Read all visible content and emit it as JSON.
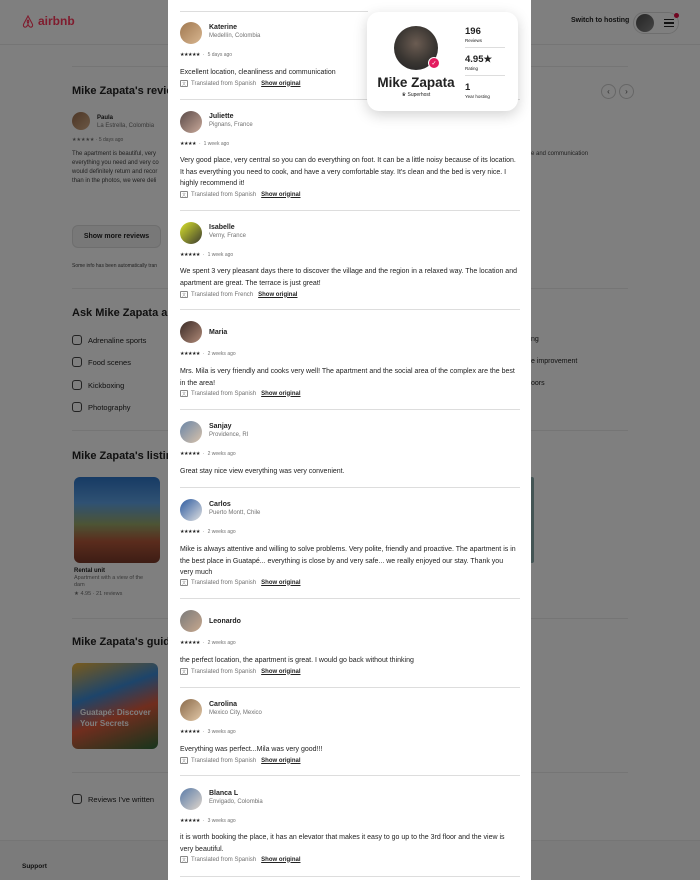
{
  "header": {
    "logo_text": "airbnb",
    "switch_label": "Switch to hosting",
    "brand_color": "#ff385c"
  },
  "background": {
    "reviews_title": "Mike Zapata's review",
    "bg_reviewer_name": "Paula",
    "bg_reviewer_loc": "La Estrella, Colombia",
    "bg_reviewer_meta": "★★★★★ · 5 days ago",
    "bg_review_text": "The apartment is beautiful, very everything you need and very co would definitely return and recor than in the photos, we were deli",
    "bg_right_text": "e and communication",
    "show_more": "Show more reviews",
    "auto_translate_note": "Some info has been automatically tran",
    "ask_title": "Ask Mike Zapata abo",
    "ask_items": [
      "Adrenaline sports",
      "Food scenes",
      "Kickboxing",
      "Photography"
    ],
    "ask_right_items": [
      "ng",
      "e improvement",
      "oors"
    ],
    "listings_title": "Mike Zapata's listings",
    "listing_type": "Rental unit",
    "listing_desc": "Apartment with a view of the dam",
    "listing_rating": "★ 4.95 · 21 reviews",
    "guide_title": "Mike Zapata's guideb",
    "guide_card": "Guatapé: Discover Your Secrets",
    "reviews_written": "Reviews I've written",
    "footer_support": "Support"
  },
  "profile": {
    "name": "Mike Zapata",
    "role": "Superhost",
    "reviews_value": "196",
    "reviews_label": "Reviews",
    "rating_value": "4.95★",
    "rating_label": "Rating",
    "years_value": "1",
    "years_label": "Year hosting"
  },
  "reviews": [
    {
      "name": "Katerine",
      "location": "Medellín, Colombia",
      "stars": "★★★★★",
      "time": "5 days ago",
      "text": "Excellent location, cleanliness and communication",
      "translated": "Translated from Spanish",
      "show_original": "Show original"
    },
    {
      "name": "Juliette",
      "location": "Pignans, France",
      "stars": "★★★★",
      "time": "1 week ago",
      "text": "Very good place, very central so you can do everything on foot. It can be a little noisy because of its location. It has everything you need to cook, and have a very comfortable stay. It's clean and the bed is very nice. I highly recommend it!",
      "translated": "Translated from Spanish",
      "show_original": "Show original"
    },
    {
      "name": "Isabelle",
      "location": "Verny, France",
      "stars": "★★★★★",
      "time": "1 week ago",
      "text": "We spent 3 very pleasant days there to discover the village and the region in a relaxed way. The location and apartment are great. The terrace is just great!",
      "translated": "Translated from French",
      "show_original": "Show original"
    },
    {
      "name": "Maria",
      "location": "",
      "stars": "★★★★★",
      "time": "2 weeks ago",
      "text": "Mrs. Mila is very friendly and cooks very well! The apartment and the social area of the complex are the best in the area!",
      "translated": "Translated from Spanish",
      "show_original": "Show original"
    },
    {
      "name": "Sanjay",
      "location": "Providence, RI",
      "stars": "★★★★★",
      "time": "2 weeks ago",
      "text": "Great stay nice view everything was very convenient.",
      "translated": "",
      "show_original": ""
    },
    {
      "name": "Carlos",
      "location": "Puerto Montt, Chile",
      "stars": "★★★★★",
      "time": "2 weeks ago",
      "text": "Mike is always attentive and willing to solve problems. Very polite, friendly and proactive. The apartment is in the best place in Guatapé... everything is close by and very safe... we really enjoyed our stay. Thank you very much",
      "translated": "Translated from Spanish",
      "show_original": "Show original"
    },
    {
      "name": "Leonardo",
      "location": "",
      "stars": "★★★★★",
      "time": "2 weeks ago",
      "text": "the perfect location, the apartment is great. I would go back without thinking",
      "translated": "Translated from Spanish",
      "show_original": "Show original"
    },
    {
      "name": "Carolina",
      "location": "Mexico City, Mexico",
      "stars": "★★★★★",
      "time": "3 weeks ago",
      "text": "Everything was perfect...Mila was very good!!!",
      "translated": "Translated from Spanish",
      "show_original": "Show original"
    },
    {
      "name": "Blanca L",
      "location": "Envigado, Colombia",
      "stars": "★★★★★",
      "time": "3 weeks ago",
      "text": "it is worth booking the place, it has an elevator that makes it easy to go up to the 3rd floor and the view is very beautiful.",
      "translated": "Translated from Spanish",
      "show_original": "Show original"
    }
  ]
}
